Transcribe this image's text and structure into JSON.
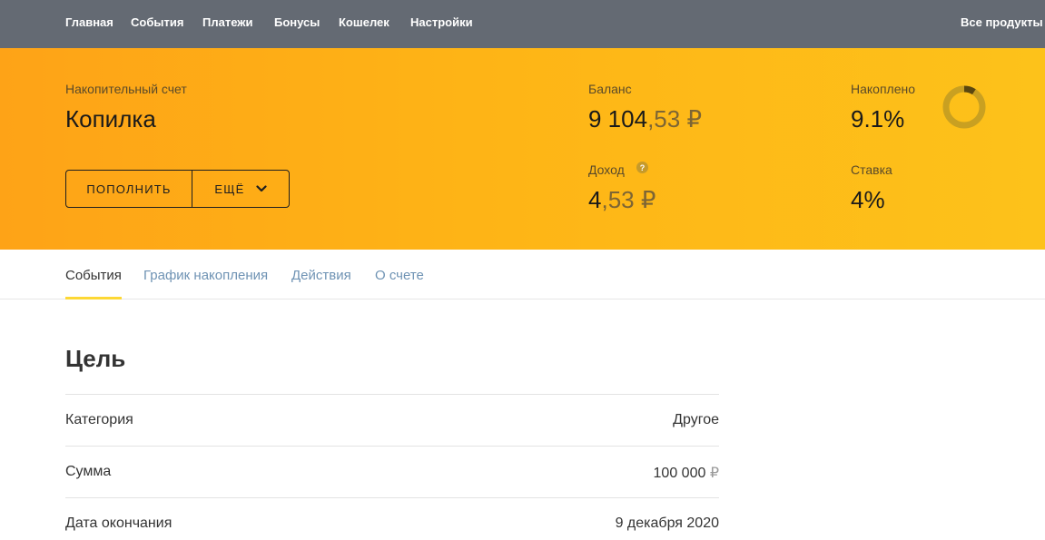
{
  "topnav": {
    "items": [
      "Главная",
      "События",
      "Платежи",
      "Бонусы",
      "Кошелек",
      "Настройки"
    ],
    "all_products": "Все продукты"
  },
  "account": {
    "type": "Накопительный счет",
    "name": "Копилка",
    "topup_label": "ПОПОЛНИТЬ",
    "more_label": "ЕЩЁ",
    "balance_label": "Баланс",
    "balance_int": "9 104",
    "balance_frac": ",53 ₽",
    "income_label": "Доход",
    "income_int": "4",
    "income_frac": ",53 ₽",
    "saved_label": "Накоплено",
    "saved_value": "9.1%",
    "saved_fraction": 0.091,
    "rate_label": "Ставка",
    "rate_value": "4%"
  },
  "tabs": [
    "События",
    "График накопления",
    "Действия",
    "О счете"
  ],
  "goal": {
    "title": "Цель",
    "rows": [
      {
        "label": "Категория",
        "value": "Другое",
        "currency": ""
      },
      {
        "label": "Сумма",
        "value": "100 000",
        "currency": " ₽"
      },
      {
        "label": "Дата окончания",
        "value": "9 декабря 2020",
        "currency": ""
      }
    ]
  },
  "colors": {
    "nav_bg": "#646a73",
    "hero_start": "#fea317",
    "hero_end": "#fdc21a",
    "tab_link": "#6f93b4",
    "tab_underline": "#fdd835",
    "donut_track": "#c9a021",
    "donut_progress": "#5a4710"
  }
}
